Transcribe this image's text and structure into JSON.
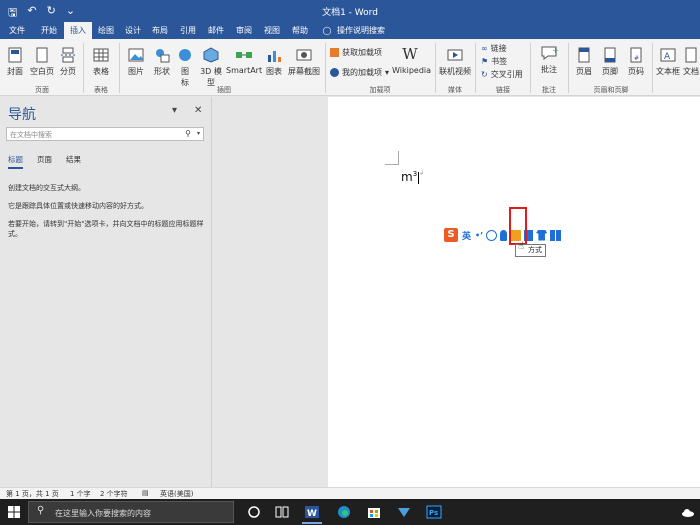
{
  "titlebar": {
    "title": "文档1 - Word"
  },
  "tabs": [
    "文件",
    "开始",
    "插入",
    "绘图",
    "设计",
    "布局",
    "引用",
    "邮件",
    "审阅",
    "视图",
    "帮助"
  ],
  "tell_me": "操作说明搜索",
  "ribbon": {
    "page_group": {
      "cover": "封面",
      "blank": "空白页",
      "break": "分页",
      "label": "页面"
    },
    "table_group": {
      "table": "表格",
      "label": "表格"
    },
    "illustrations": {
      "pictures": "图片",
      "shapes": "形状",
      "icons": "图\n标",
      "models": "3D 模\n型",
      "smartart": "SmartArt",
      "chart": "图表",
      "screenshot": "屏幕截图",
      "label": "插图"
    },
    "addins": {
      "get": "获取加载项",
      "mine": "我的加载项",
      "wiki": "Wikipedia",
      "label": "加载项"
    },
    "media": {
      "video": "联机视频",
      "label": "媒体"
    },
    "links": {
      "link": "链接",
      "bookmark": "书签",
      "crossref": "交叉引用",
      "label": "链接"
    },
    "comments": {
      "comment": "批注",
      "label": "批注"
    },
    "header_footer": {
      "header": "页眉",
      "footer": "页脚",
      "page_num": "页码",
      "label": "页眉和页脚"
    },
    "text": {
      "textbox": "文本框",
      "more": "文档"
    }
  },
  "nav": {
    "title": "导航",
    "search_placeholder": "在文档中搜索",
    "tabs": [
      "标题",
      "页面",
      "结果"
    ],
    "text1": "创建文档的交互式大纲。",
    "text2": "它是跟踪具体位置或快速移动内容的好方式。",
    "text3": "若要开始，请转到\"开始\"选项卡，并向文档中的标题应用标题样式。"
  },
  "document": {
    "base": "m",
    "sup": "3"
  },
  "ime": {
    "mode": "英",
    "tooltip": "方式"
  },
  "status": {
    "page": "第 1 页，共 1 页",
    "words": "1 个字",
    "chars": "2 个字符",
    "lang": "英语(美国)"
  },
  "taskbar": {
    "search_placeholder": "在这里输入你要搜索的内容"
  },
  "colors": {
    "accent": "#2b579a",
    "highlight": "#e21a1a",
    "ime_logo": "#ee5a24"
  }
}
